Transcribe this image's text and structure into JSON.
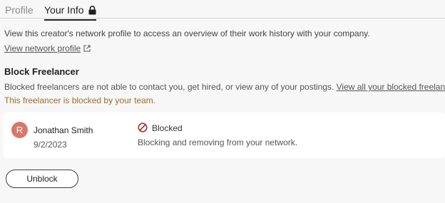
{
  "tabs": {
    "profile": "Profile",
    "your_info": "Your Info"
  },
  "intro": {
    "text": "View this creator's network profile to access an overview of their work history with your company.",
    "link": "View network profile"
  },
  "block": {
    "title": "Block Freelancer",
    "description": "Blocked freelancers are not able to contact you, get hired, or view any of your postings.",
    "view_all_link": "View all your blocked freelancers.",
    "notice": "This freelancer is blocked by your team."
  },
  "freelancer": {
    "initial": "R",
    "name": "Jonathan Smith",
    "date": "9/2/2023",
    "status": "Blocked",
    "status_detail": "Blocking and removing from your network."
  },
  "actions": {
    "unblock": "Unblock"
  },
  "colors": {
    "avatar": "#d9776c",
    "notice": "#9b6b2f",
    "blocked_icon": "#9b3a2e"
  }
}
